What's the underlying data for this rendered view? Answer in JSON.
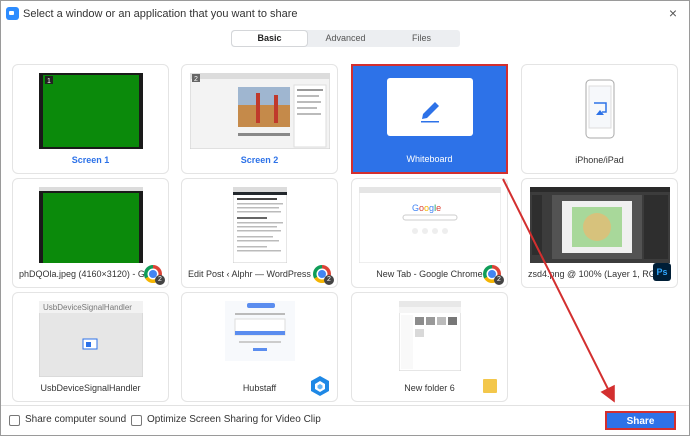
{
  "window": {
    "title": "Select a window or an application that you want to share",
    "close_label": "×"
  },
  "tabs": [
    {
      "label": "Basic",
      "active": true
    },
    {
      "label": "Advanced",
      "active": false
    },
    {
      "label": "Files",
      "active": false
    }
  ],
  "tiles": [
    {
      "label": "Screen 1",
      "number": "1"
    },
    {
      "label": "Screen 2",
      "number": "2"
    },
    {
      "label": "Whiteboard"
    },
    {
      "label": "iPhone/iPad"
    },
    {
      "label": "phDQOla.jpeg (4160×3120) - Goo...",
      "badge_count": "2"
    },
    {
      "label": "Edit Post ‹ Alphr — WordPress - ...",
      "badge_count": "2"
    },
    {
      "label": "New Tab - Google Chrome",
      "badge_count": "2"
    },
    {
      "label": "zsd4.png @ 100% (Layer 1, RGB/8)",
      "badge": "Ps"
    },
    {
      "label": "UsbDeviceSignalHandler",
      "thumb_title": "UsbDeviceSignalHandler"
    },
    {
      "label": "Hubstaff"
    },
    {
      "label": "New folder 6"
    }
  ],
  "options": {
    "share_sound": "Share computer sound",
    "optimize_video": "Optimize Screen Sharing for Video Clip"
  },
  "share_button": "Share",
  "colors": {
    "accent": "#2d72e8",
    "highlight": "#d32f2f",
    "screen_green": "#0b8a0b"
  }
}
